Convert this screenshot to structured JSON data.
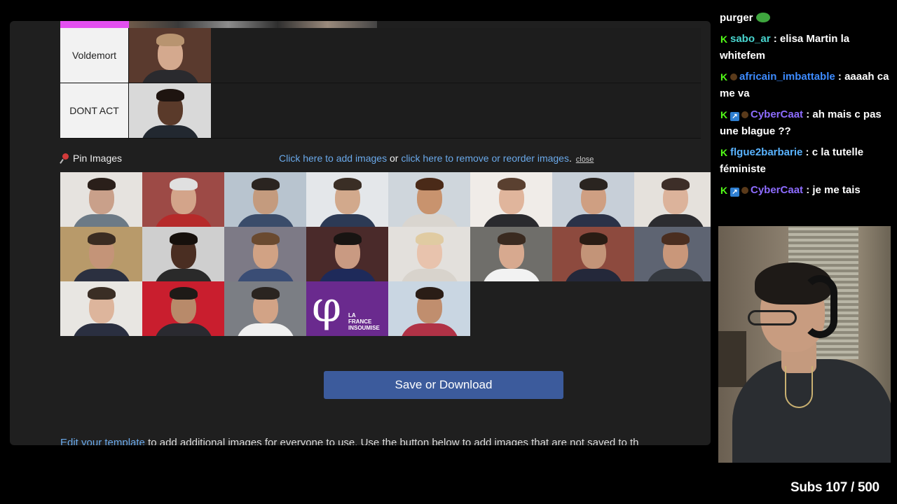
{
  "tiers": [
    {
      "label": "Voldemort",
      "photos": [
        {
          "skin": "#d4a98e",
          "hair": "#b89470",
          "bg": "#5a3a2e",
          "shirt": "#2a2a2e"
        }
      ]
    },
    {
      "label": "DONT ACT",
      "photos": [
        {
          "skin": "#5a3a2a",
          "hair": "#1e1410",
          "bg": "#d9d9d9",
          "shirt": "#222830"
        }
      ]
    }
  ],
  "pin_section": {
    "title": "Pin Images",
    "add_link": "Click here to add images",
    "or_text": " or ",
    "remove_link": "click here to remove or reorder images",
    "period": ".",
    "close": "close"
  },
  "image_pool": [
    {
      "skin": "#c9a08a",
      "hair": "#2a1f1a",
      "bg": "#e6e3df",
      "shirt": "#6c7a86"
    },
    {
      "skin": "#d3a48a",
      "hair": "#e0e0e0",
      "bg": "#9d4a46",
      "shirt": "#b62a2a"
    },
    {
      "skin": "#c49b7e",
      "hair": "#2a2420",
      "bg": "#b8c4cf",
      "shirt": "#3a4c6a"
    },
    {
      "skin": "#d2a98c",
      "hair": "#3a2e25",
      "bg": "#e4e7ea",
      "shirt": "#2c3a55"
    },
    {
      "skin": "#c8936e",
      "hair": "#4a2a18",
      "bg": "#cfd6dc",
      "shirt": "#d9d5cf"
    },
    {
      "skin": "#e0b59c",
      "hair": "#5a4030",
      "bg": "#f0ece8",
      "shirt": "#2a2a2e"
    },
    {
      "skin": "#cf9f82",
      "hair": "#2a2420",
      "bg": "#c7cfd8",
      "shirt": "#2a3248"
    },
    {
      "skin": "#dcb39b",
      "hair": "#3d2e28",
      "bg": "#e5e1dc",
      "shirt": "#2c2c30"
    },
    {
      "skin": "#c49478",
      "hair": "#3a2c22",
      "bg": "#b89a6a",
      "shirt": "#2b3040"
    },
    {
      "skin": "#4a2e22",
      "hair": "#16100c",
      "bg": "#cfcfcf",
      "shirt": "#2a2a2a"
    },
    {
      "skin": "#d1a284",
      "hair": "#6a4a30",
      "bg": "#7d7a86",
      "shirt": "#3a4d75"
    },
    {
      "skin": "#c99a82",
      "hair": "#181412",
      "bg": "#4a2a2a",
      "shirt": "#1e2a5a"
    },
    {
      "skin": "#e8c3ad",
      "hair": "#e0cba2",
      "bg": "#e3e0dc",
      "shirt": "#d8d3cc"
    },
    {
      "skin": "#d7a98f",
      "hair": "#3a2a20",
      "bg": "#6f6e6a",
      "shirt": "#f2f2f2"
    },
    {
      "skin": "#c39478",
      "hair": "#2a1c14",
      "bg": "#8d4a3e",
      "shirt": "#24283a"
    },
    {
      "skin": "#c9977a",
      "hair": "#4a2e20",
      "bg": "#5e6472",
      "shirt": "#34383e"
    },
    {
      "skin": "#ddb59c",
      "hair": "#3a2e25",
      "bg": "#e8e6e2",
      "shirt": "#2a2f40"
    },
    {
      "skin": "#b88a6a",
      "hair": "#1e1a17",
      "bg": "#c91e2e",
      "shirt": "#2a2a30"
    },
    {
      "skin": "#d2a386",
      "hair": "#2a2420",
      "bg": "#7b7e84",
      "shirt": "#f0f0f0"
    },
    {
      "logo": true
    },
    {
      "skin": "#c08e6e",
      "hair": "#2a1d16",
      "bg": "#c9d6e2",
      "shirt": "#b03246"
    }
  ],
  "lfi_logo": {
    "symbol": "φ",
    "line1": "LA",
    "line2": "FRANCE",
    "line3": "INSOUMISE"
  },
  "save_button": "Save or Download",
  "footer": {
    "link": "Edit your template",
    "text": " to add additional images for everyone to use. Use the button below to add images that are not saved to th"
  },
  "chat": [
    {
      "badges": [],
      "user": "",
      "text": "purger",
      "partial_top": true,
      "emoji": "frog"
    },
    {
      "badges": [
        "k"
      ],
      "user": "sabo_ar",
      "color": "cyan",
      "text": "elisa Martin la whitefem"
    },
    {
      "badges": [
        "k",
        "fly"
      ],
      "user": "africain_imbattable",
      "color": "blue",
      "text": "aaaah ca me va"
    },
    {
      "badges": [
        "k",
        "sub",
        "fly"
      ],
      "user": "CyberCaat",
      "color": "purple",
      "text": "ah mais c pas une blague ??"
    },
    {
      "badges": [
        "k"
      ],
      "user": "flgue2barbarie",
      "color": "blue2",
      "text": "c la tutelle féministe"
    },
    {
      "badges": [
        "k",
        "sub",
        "fly"
      ],
      "user": "CyberCaat",
      "color": "purple",
      "text": "je me tais"
    }
  ],
  "subs_counter": "Subs 107 / 500"
}
